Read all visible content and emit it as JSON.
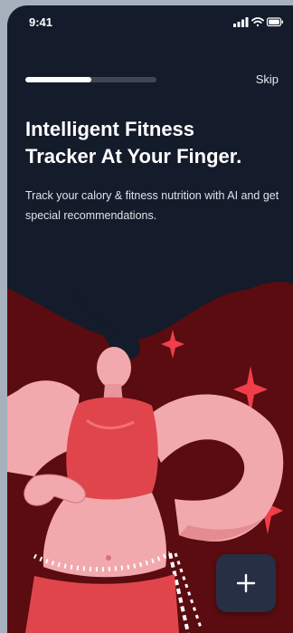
{
  "status_bar": {
    "time": "9:41"
  },
  "onboarding": {
    "progress": 0.5,
    "skip_label": "Skip",
    "headline_line1": "Intelligent Fitness",
    "headline_line2": "Tracker At Your Finger.",
    "subtitle": "Track your calory & fitness nutrition with AI and get special recommendations."
  },
  "fab": {
    "icon": "plus-icon"
  },
  "colors": {
    "background": "#141b2a",
    "accent_red": "#e1454c",
    "dark_red": "#5c0d10",
    "skin_pink": "#f2a9ad"
  }
}
